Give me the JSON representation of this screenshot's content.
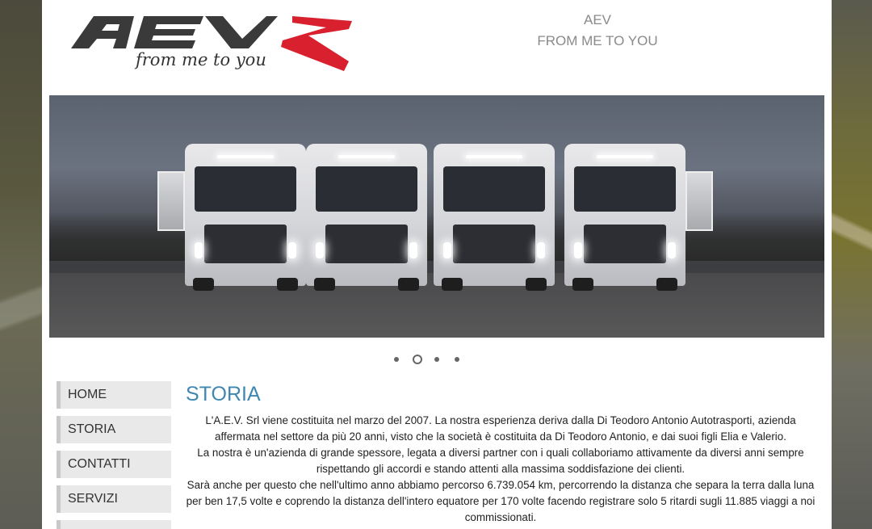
{
  "header": {
    "logo_text": "AEV",
    "logo_tagline": "from me to you",
    "site_title": "AEV",
    "site_subtitle": "FROM ME TO YOU"
  },
  "slider": {
    "slide_count": 4,
    "active_index": 1
  },
  "colors": {
    "accent": "#3f87b0",
    "logo_dark": "#3a3a3a",
    "logo_red": "#d8202f",
    "nav_bg": "#e9e9e9"
  },
  "nav": {
    "items": [
      {
        "label": "HOME"
      },
      {
        "label": "STORIA"
      },
      {
        "label": "CONTATTI"
      },
      {
        "label": "SERVIZI"
      }
    ]
  },
  "content": {
    "title": "STORIA",
    "paragraph": "L'A.E.V. Srl viene costituita nel marzo del 2007. La nostra esperienza deriva dalla Di Teodoro Antonio Autotrasporti, azienda affermata nel settore da più 20 anni, visto che la società è costituita da Di Teodoro Antonio, e dai suoi figli Elia e Valerio.\nLa nostra è un'azienda di grande spessore, legata a diversi partner con i quali collaboriamo attivamente da diversi anni sempre rispettando gli accordi e stando attenti alla massima soddisfazione dei clienti.\nSarà anche per questo che nell'ultimo anno abbiamo percorso 6.739.054 km, percorrendo la distanza che separa la terra dalla luna per ben 17,5 volte e coprendo la distanza dell'intero equatore per 170 volte facendo registrare solo 5 ritardi sugli 11.885 viaggi a noi commissionati."
  }
}
